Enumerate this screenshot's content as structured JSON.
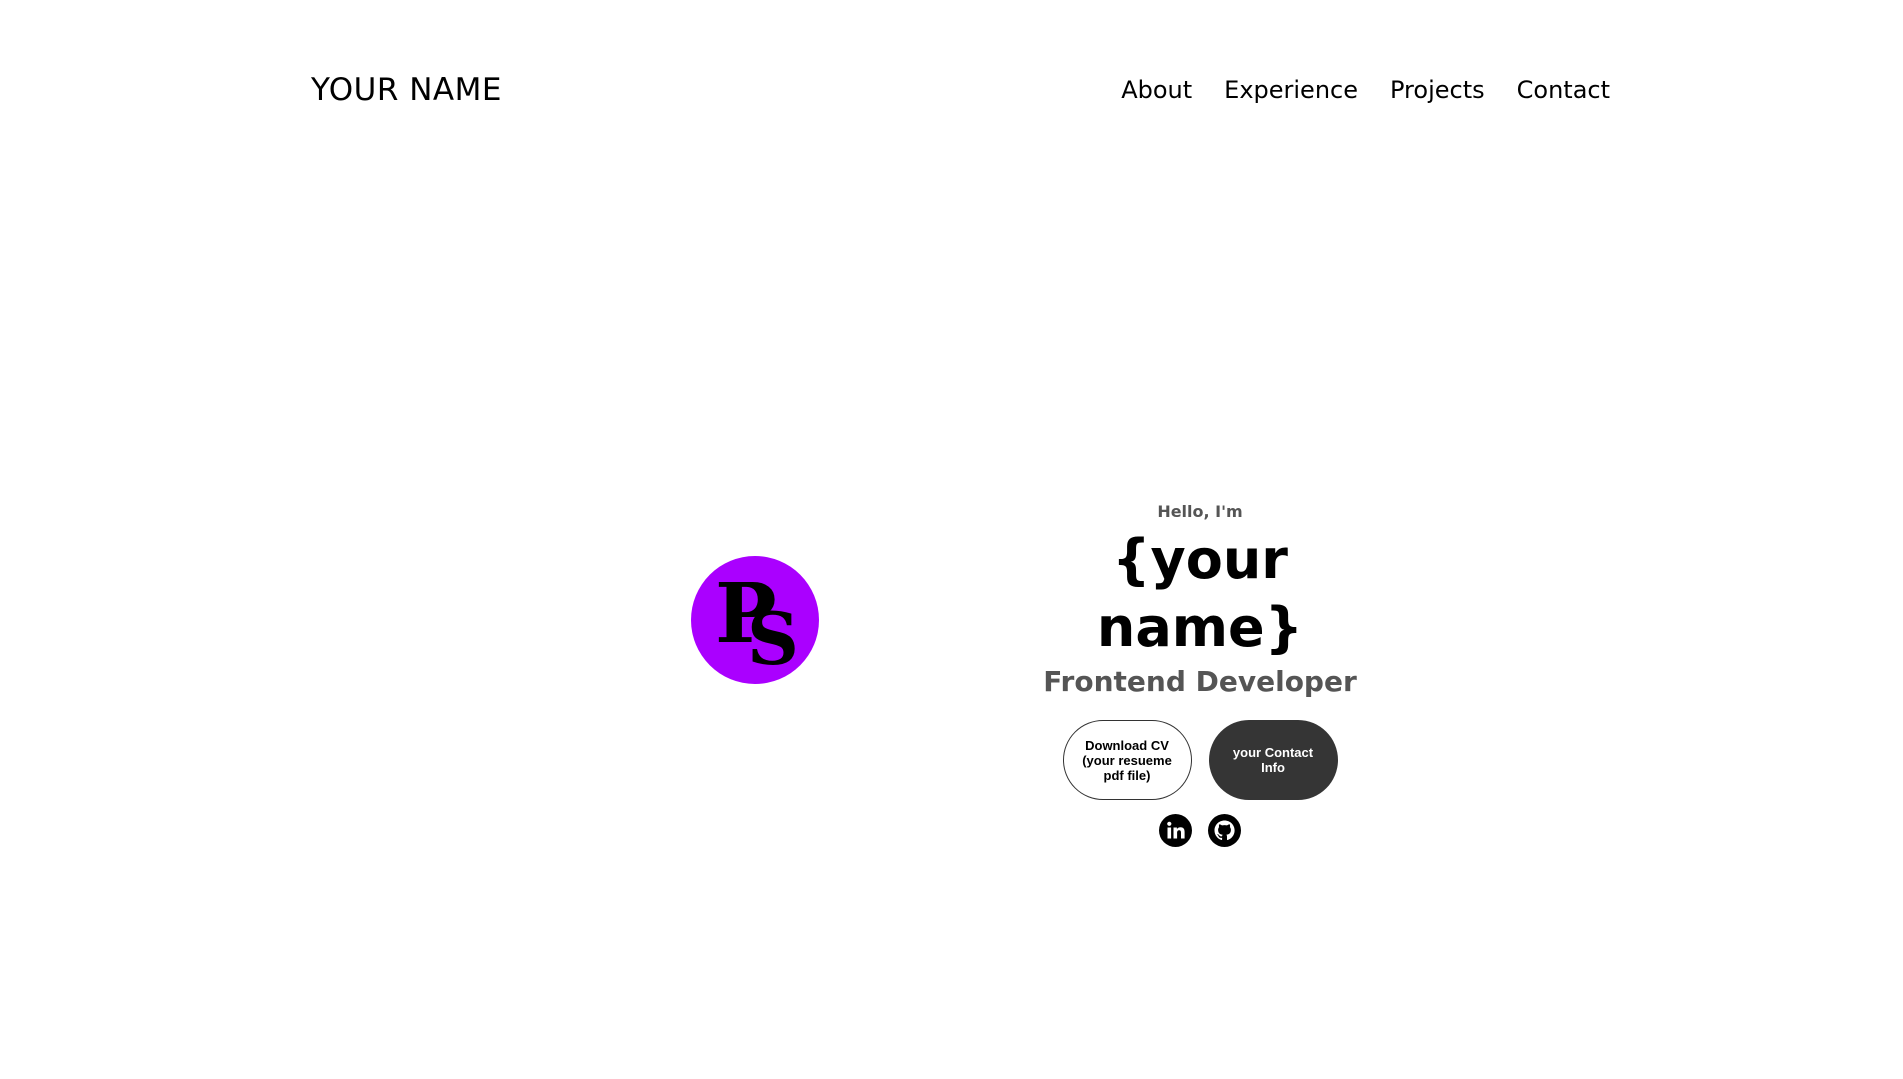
{
  "nav": {
    "logo": "YOUR NAME",
    "links": [
      {
        "label": "About"
      },
      {
        "label": "Experience"
      },
      {
        "label": "Projects"
      },
      {
        "label": "Contact"
      }
    ]
  },
  "profile": {
    "logo_text": "PS",
    "logo_color": "#aa00ff"
  },
  "hero": {
    "greeting": "Hello, I'm",
    "name": "{your name}",
    "role": "Frontend Developer",
    "buttons": {
      "download": "Download CV (your resueme pdf file)",
      "contact": "your Contact Info"
    },
    "socials": [
      {
        "icon": "linkedin-icon"
      },
      {
        "icon": "github-icon"
      }
    ]
  }
}
